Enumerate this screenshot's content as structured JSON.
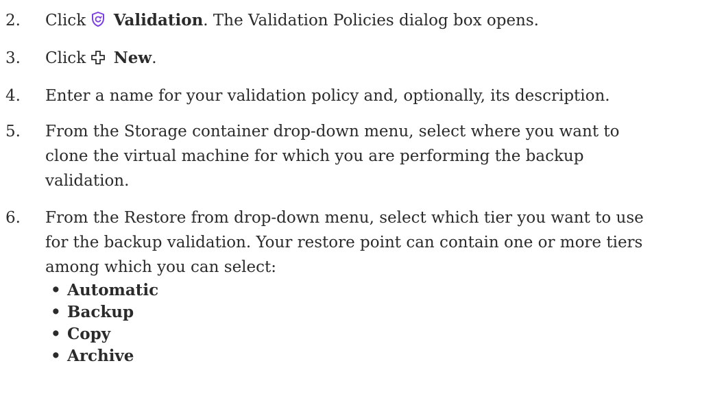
{
  "steps": [
    {
      "num": "2.",
      "pre": "Click",
      "icon": "validation-shield-icon",
      "bold": "Validation",
      "post": ". The Validation Policies dialog box opens."
    },
    {
      "num": "3.",
      "pre": "Click",
      "icon": "plus-icon",
      "bold": "New",
      "post": "."
    },
    {
      "num": "4.",
      "text": "Enter a name for your validation policy and, optionally, its description."
    },
    {
      "num": "5.",
      "lines": [
        "From the Storage container drop-down menu, select where you want to",
        "clone the virtual machine for which you are performing the backup",
        "validation."
      ]
    },
    {
      "num": "6.",
      "lines": [
        "From the Restore from drop-down menu, select which tier you want to use",
        "for the backup validation. Your restore point can contain one or more tiers",
        "among which you can select:"
      ],
      "bullets": [
        "Automatic",
        "Backup",
        "Copy",
        "Archive"
      ]
    }
  ],
  "colors": {
    "text": "#2b2b2b",
    "icon_accent": "#7b3fe4"
  }
}
